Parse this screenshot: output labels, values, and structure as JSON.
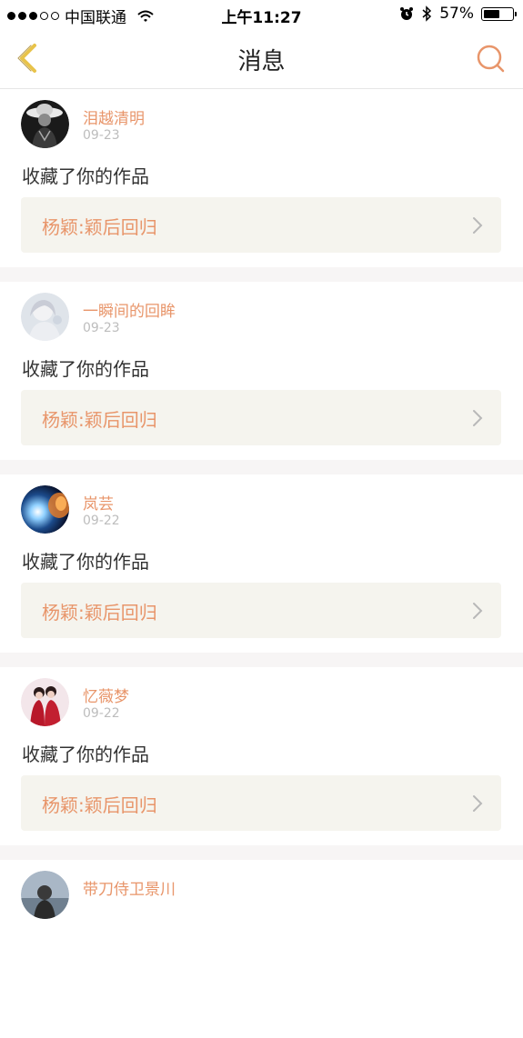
{
  "status_bar": {
    "carrier": "中国联通",
    "time": "上午11:27",
    "battery": "57%",
    "battery_level": 0.57,
    "signal_bars_filled": 3,
    "signal_bars_total": 5
  },
  "nav": {
    "title": "消息",
    "back_icon": "chevron-left-icon",
    "search_icon": "search-icon"
  },
  "colors": {
    "accent": "#e8956a",
    "back_arrow": "#e8c34a",
    "card_bg": "#f5f4ee",
    "separator": "#f7f5f5"
  },
  "messages": [
    {
      "user": "泪越清明",
      "date": "09-23",
      "action": "收藏了你的作品",
      "work": "杨颖:颖后回归"
    },
    {
      "user": "一瞬间的回眸",
      "date": "09-23",
      "action": "收藏了你的作品",
      "work": "杨颖:颖后回归"
    },
    {
      "user": "岚芸",
      "date": "09-22",
      "action": "收藏了你的作品",
      "work": "杨颖:颖后回归"
    },
    {
      "user": "忆薇梦",
      "date": "09-22",
      "action": "收藏了你的作品",
      "work": "杨颖:颖后回归"
    },
    {
      "user": "带刀侍卫景川"
    }
  ]
}
